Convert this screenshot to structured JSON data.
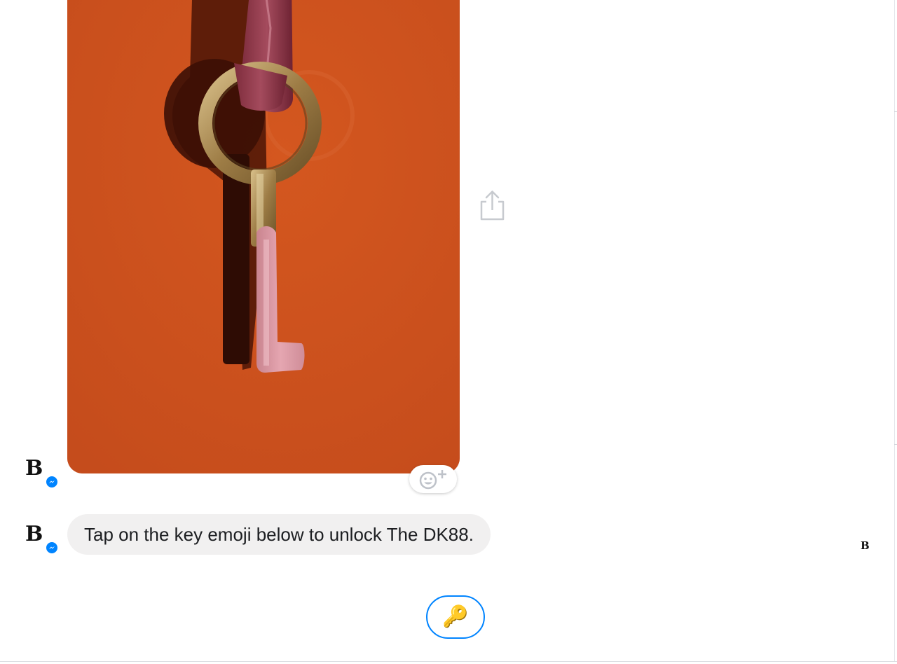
{
  "conversation": {
    "sender_initial": "B",
    "image_message": {
      "background_color": "#cf5320",
      "share_icon": "share-icon",
      "reaction_icon": "add-reaction-icon"
    },
    "text_message": {
      "text": "Tap on the key emoji below to unlock The DK88."
    },
    "seen_indicator": "B",
    "quick_reply": {
      "label": "🔑",
      "border_color": "#0084ff"
    }
  }
}
